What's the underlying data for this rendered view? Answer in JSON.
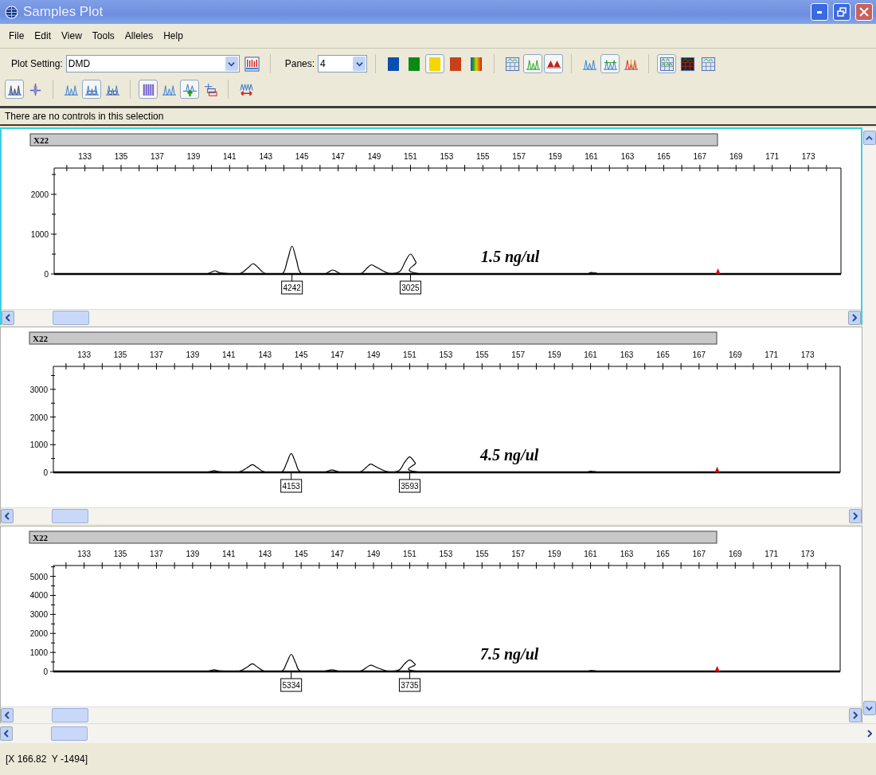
{
  "window": {
    "title": "Samples Plot"
  },
  "menu": [
    "File",
    "Edit",
    "View",
    "Tools",
    "Alleles",
    "Help"
  ],
  "toolbar": {
    "plot_setting": {
      "label": "Plot Setting:",
      "value": "DMD"
    },
    "panes": {
      "label": "Panes:",
      "value": "4"
    },
    "row_1_groups": [
      [
        {
          "kind": "plot-grid",
          "selected": false
        }
      ],
      [
        {
          "kind": "swatch",
          "color": "#0a4fb0",
          "selected": false
        },
        {
          "kind": "swatch",
          "color": "#0a8a14",
          "selected": false
        },
        {
          "kind": "swatch",
          "color": "#f2d800",
          "selected": true
        },
        {
          "kind": "swatch",
          "color": "#c8401a",
          "selected": false
        },
        {
          "kind": "rainbow",
          "selected": false
        }
      ],
      [
        {
          "kind": "table",
          "selected": false
        },
        {
          "kind": "peaks",
          "selected": true
        },
        {
          "kind": "triangles",
          "selected": true
        }
      ],
      [
        {
          "kind": "peaks-multi",
          "selected": false
        },
        {
          "kind": "peaks-overlay",
          "selected": true
        },
        {
          "kind": "peaks-color",
          "selected": false
        }
      ],
      [
        {
          "kind": "grid",
          "selected": true
        },
        {
          "kind": "table-dark",
          "selected": false
        },
        {
          "kind": "table-light",
          "selected": false
        }
      ]
    ],
    "row_2_groups": [
      [
        {
          "kind": "peaks-filled",
          "selected": true
        },
        {
          "kind": "single-peak",
          "selected": false
        }
      ],
      [
        {
          "kind": "peaks-small",
          "selected": false
        },
        {
          "kind": "peaks-boxes",
          "selected": true
        },
        {
          "kind": "peaks-stacked",
          "selected": false
        }
      ],
      [
        {
          "kind": "bars",
          "selected": true
        },
        {
          "kind": "peaks-small",
          "selected": false
        },
        {
          "kind": "peaks-arrow-up",
          "selected": true
        },
        {
          "kind": "layers",
          "selected": false
        }
      ],
      [
        {
          "kind": "peaks-arrow",
          "selected": false
        }
      ]
    ]
  },
  "info_bar": "There are no controls in this selection",
  "panes": [
    {
      "selected": true,
      "marker": "X22",
      "note": "1.5 ng/ul",
      "chart_data": {
        "type": "line",
        "xlim": [
          131.3,
          174.8
        ],
        "ylim": [
          0,
          2660
        ],
        "xticks": [
          133,
          135,
          137,
          139,
          141,
          143,
          145,
          147,
          149,
          151,
          153,
          155,
          157,
          159,
          161,
          163,
          165,
          167,
          169,
          171,
          173
        ],
        "yticks": [
          0,
          1000,
          2000
        ],
        "x": [
          131.5,
          135.5,
          137,
          139.5,
          139.9,
          140.2,
          140.5,
          141.5,
          142.0,
          142.3,
          142.6,
          143.0,
          143.9,
          144.2,
          144.45,
          144.7,
          145.0,
          146.2,
          146.7,
          147.2,
          148.2,
          148.6,
          148.85,
          149.2,
          149.8,
          150.4,
          150.7,
          151.0,
          151.3,
          151.7,
          160.5,
          161.0,
          161.5,
          168.0,
          174.7
        ],
        "series": [
          {
            "color": "#000000",
            "values": [
              0,
              0,
              0,
              0,
              30,
              80,
              30,
              0,
              150,
              260,
              150,
              10,
              0,
              350,
              700,
              350,
              0,
              0,
              100,
              0,
              0,
              150,
              230,
              150,
              20,
              60,
              300,
              500,
              300,
              0,
              0,
              40,
              0,
              0,
              0
            ]
          }
        ],
        "annotations": [
          "4242",
          "3025"
        ]
      }
    },
    {
      "selected": false,
      "marker": "X22",
      "note": "4.5 ng/ul",
      "chart_data": {
        "type": "line",
        "xlim": [
          131.3,
          174.8
        ],
        "ylim": [
          0,
          3830
        ],
        "xticks": [
          133,
          135,
          137,
          139,
          141,
          143,
          145,
          147,
          149,
          151,
          153,
          155,
          157,
          159,
          161,
          163,
          165,
          167,
          169,
          171,
          173
        ],
        "yticks": [
          0,
          1000,
          2000,
          3000
        ],
        "x": [
          131.5,
          135.5,
          137,
          139.5,
          139.9,
          140.2,
          140.5,
          141.5,
          142.0,
          142.3,
          142.6,
          143.0,
          143.9,
          144.2,
          144.45,
          144.7,
          145.0,
          146.2,
          146.7,
          147.2,
          148.2,
          148.6,
          148.85,
          149.2,
          149.8,
          150.4,
          150.7,
          151.0,
          151.3,
          151.7,
          160.5,
          161.0,
          161.5,
          168.0,
          174.7
        ],
        "series": [
          {
            "color": "#000000",
            "values": [
              0,
              0,
              0,
              0,
              20,
              60,
              20,
              0,
              160,
              280,
              160,
              10,
              0,
              340,
              680,
              340,
              0,
              0,
              80,
              0,
              0,
              180,
              300,
              180,
              20,
              60,
              340,
              560,
              340,
              0,
              0,
              40,
              0,
              0,
              0
            ]
          }
        ],
        "annotations": [
          "4153",
          "3593"
        ]
      }
    },
    {
      "selected": false,
      "marker": "X22",
      "note": "7.5 ng/ul",
      "chart_data": {
        "type": "line",
        "xlim": [
          131.3,
          174.8
        ],
        "ylim": [
          0,
          5570
        ],
        "xticks": [
          133,
          135,
          137,
          139,
          141,
          143,
          145,
          147,
          149,
          151,
          153,
          155,
          157,
          159,
          161,
          163,
          165,
          167,
          169,
          171,
          173
        ],
        "yticks": [
          0,
          1000,
          2000,
          3000,
          4000,
          5000
        ],
        "x": [
          131.5,
          135.5,
          137,
          139.5,
          139.9,
          140.2,
          140.5,
          141.5,
          142.0,
          142.3,
          142.6,
          143.0,
          143.9,
          144.2,
          144.45,
          144.7,
          145.0,
          146.2,
          146.7,
          147.2,
          148.2,
          148.6,
          148.85,
          149.2,
          149.8,
          150.4,
          150.7,
          151.0,
          151.3,
          151.7,
          160.5,
          161.0,
          161.5,
          168.0,
          174.7
        ],
        "series": [
          {
            "color": "#000000",
            "values": [
              0,
              0,
              0,
              0,
              30,
              90,
              30,
              0,
              220,
              400,
              220,
              10,
              0,
              450,
              900,
              450,
              0,
              0,
              90,
              0,
              0,
              200,
              330,
              200,
              20,
              80,
              380,
              600,
              380,
              0,
              0,
              50,
              0,
              0,
              0
            ]
          }
        ],
        "annotations": [
          "5334",
          "3735"
        ]
      }
    }
  ],
  "status_bar": "[X 166.82  Y -1494]"
}
